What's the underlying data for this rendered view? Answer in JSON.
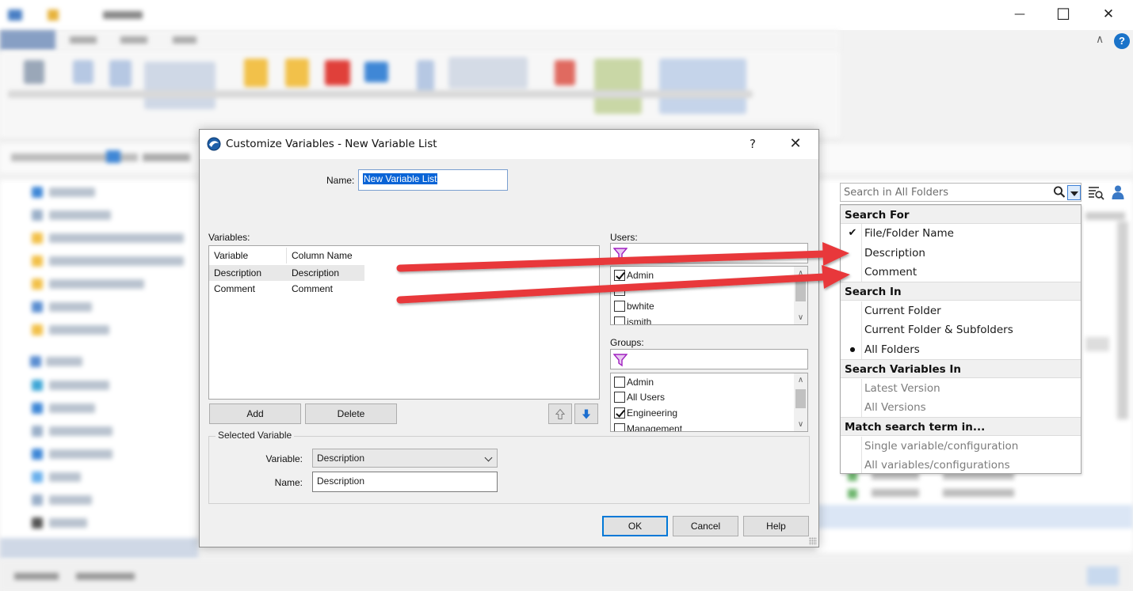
{
  "dialog": {
    "title": "Customize Variables - New Variable List",
    "help_glyph": "?",
    "close_glyph": "✕",
    "name_label": "Name:",
    "name_value": "New Variable List",
    "variables_label": "Variables:",
    "table": {
      "columns": [
        "Variable",
        "Column Name"
      ],
      "rows": [
        [
          "Description",
          "Description"
        ],
        [
          "Comment",
          "Comment"
        ]
      ]
    },
    "add_label": "Add",
    "delete_label": "Delete",
    "users_label": "Users:",
    "users": [
      {
        "name": "Admin",
        "checked": true
      },
      {
        "name": "",
        "checked": false
      },
      {
        "name": "bwhite",
        "checked": false
      },
      {
        "name": "jsmith",
        "checked": false
      }
    ],
    "groups_label": "Groups:",
    "groups": [
      {
        "name": "Admin",
        "checked": false
      },
      {
        "name": "All Users",
        "checked": false
      },
      {
        "name": "Engineering",
        "checked": true
      },
      {
        "name": "Management",
        "checked": false
      }
    ],
    "selected_variable": {
      "legend": "Selected Variable",
      "variable_label": "Variable:",
      "variable_value": "Description",
      "name_label": "Name:",
      "name_value": "Description"
    },
    "ok_label": "OK",
    "cancel_label": "Cancel",
    "help_label": "Help"
  },
  "search": {
    "placeholder": "Search in All Folders"
  },
  "search_menu": {
    "sections": [
      {
        "header": "Search For",
        "items": [
          {
            "label": "File/Folder Name",
            "mark": "check",
            "disabled": false
          },
          {
            "label": "Description",
            "mark": "",
            "disabled": false
          },
          {
            "label": "Comment",
            "mark": "",
            "disabled": false
          }
        ]
      },
      {
        "header": "Search In",
        "items": [
          {
            "label": "Current Folder",
            "mark": "",
            "disabled": false
          },
          {
            "label": "Current Folder & Subfolders",
            "mark": "",
            "disabled": false
          },
          {
            "label": "All Folders",
            "mark": "bullet",
            "disabled": false
          }
        ]
      },
      {
        "header": "Search Variables In",
        "items": [
          {
            "label": "Latest Version",
            "mark": "",
            "disabled": true
          },
          {
            "label": "All Versions",
            "mark": "",
            "disabled": true
          }
        ]
      },
      {
        "header": "Match search term in...",
        "items": [
          {
            "label": "Single variable/configuration",
            "mark": "",
            "disabled": true
          },
          {
            "label": "All variables/configurations",
            "mark": "",
            "disabled": true
          }
        ]
      }
    ],
    "check_glyph": "✔",
    "bullet_glyph": "●"
  },
  "window": {
    "minimize_glyph": "—",
    "maximize_glyph": "☐",
    "close_glyph": "✕",
    "help_glyph": "?",
    "collapse_glyph": "∧"
  },
  "colors": {
    "arrow": "#e8393a",
    "accent": "#0078d7",
    "filter": "#a020c0"
  }
}
